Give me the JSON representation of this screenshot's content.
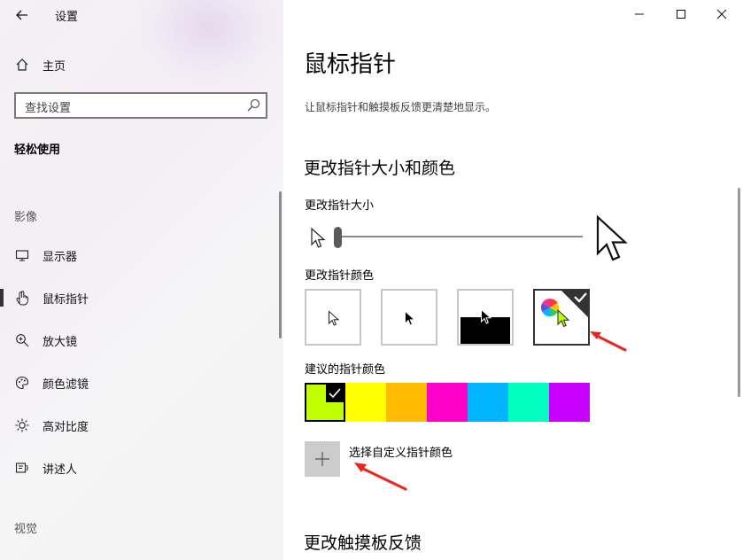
{
  "window": {
    "title": "设置"
  },
  "sidebar": {
    "home_label": "主页",
    "search_placeholder": "查找设置",
    "section_heading": "轻松使用",
    "group_vision": "影像",
    "items": [
      {
        "label": "显示器",
        "icon": "monitor-icon"
      },
      {
        "label": "鼠标指针",
        "icon": "pointer-hand-icon",
        "active": true
      },
      {
        "label": "放大镜",
        "icon": "magnifier-icon"
      },
      {
        "label": "颜色滤镜",
        "icon": "palette-icon"
      },
      {
        "label": "高对比度",
        "icon": "brightness-icon"
      },
      {
        "label": "讲述人",
        "icon": "narrator-icon"
      }
    ],
    "group_hearing": "视觉"
  },
  "main": {
    "title": "鼠标指针",
    "description": "让鼠标指针和触摸板反馈更清楚地显示。",
    "section_size_color": "更改指针大小和颜色",
    "size_label": "更改指针大小",
    "size_value": 0.0,
    "color_label": "更改指针颜色",
    "color_options": [
      "white",
      "black",
      "inverted",
      "custom"
    ],
    "selected_color_option": "custom",
    "suggested_label": "建议的指针颜色",
    "suggested_colors": [
      "#bfff00",
      "#ffff00",
      "#ffbb00",
      "#ff00c8",
      "#00b4ff",
      "#00ffbf",
      "#c800ff"
    ],
    "selected_suggested": "#bfff00",
    "custom_color_label": "选择自定义指针颜色",
    "section_touchpad": "更改触摸板反馈"
  },
  "colors": {
    "accent_arrow": "#e8261f"
  }
}
